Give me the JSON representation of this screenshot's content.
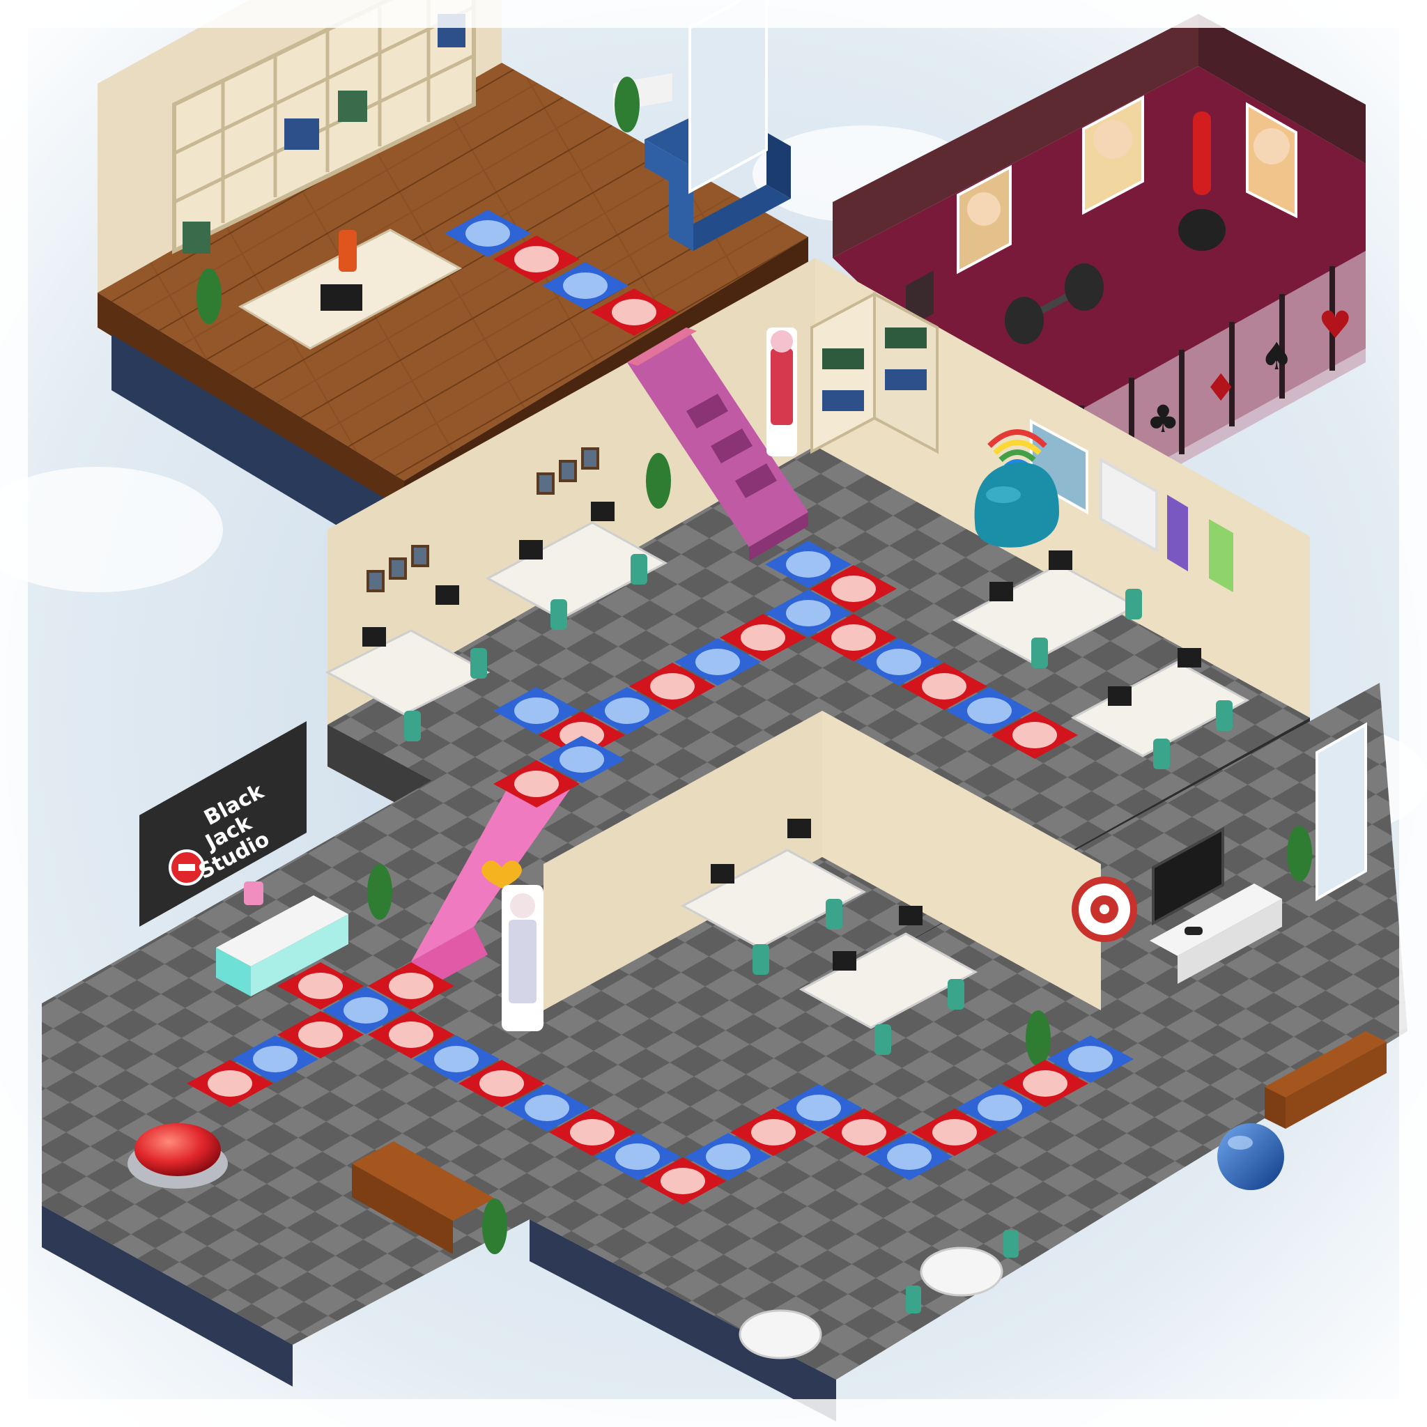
{
  "scene": {
    "studio_sign": {
      "line1": "Black",
      "line2": "Jack",
      "line3": "Studio"
    },
    "card_suits": [
      "♣",
      "♦",
      "♠",
      "♥"
    ],
    "colors": {
      "sky": "#dfe9f1",
      "floor_dark": "#6d6d6d",
      "floor_light": "#8f8f8f",
      "wood_floor": "#8a4f22",
      "gym_floor": "#7a1a3a",
      "wall_beige": "#e9dcc0",
      "tile_red": "#d4141c",
      "tile_red_dot": "#f7c4c0",
      "tile_blue": "#2e64d6",
      "tile_blue_dot": "#9fc2f4",
      "slide_purple": "#c05aa5",
      "slide_pink": "#f07ac0",
      "sofa_blue": "#234d8a",
      "sofa_brown": "#a5561f",
      "big_button_red": "#e1262b",
      "exercise_ball": "#1f5fb8",
      "chair_teal": "#3aa58a"
    },
    "icons": [
      "big-red-button-icon",
      "exercise-ball-icon",
      "dartboard-icon",
      "television-icon",
      "game-controller-icon",
      "dumbbell-icon",
      "punching-bag-icon",
      "beanbag-icon",
      "heart-icon",
      "rainbow-icon"
    ]
  }
}
